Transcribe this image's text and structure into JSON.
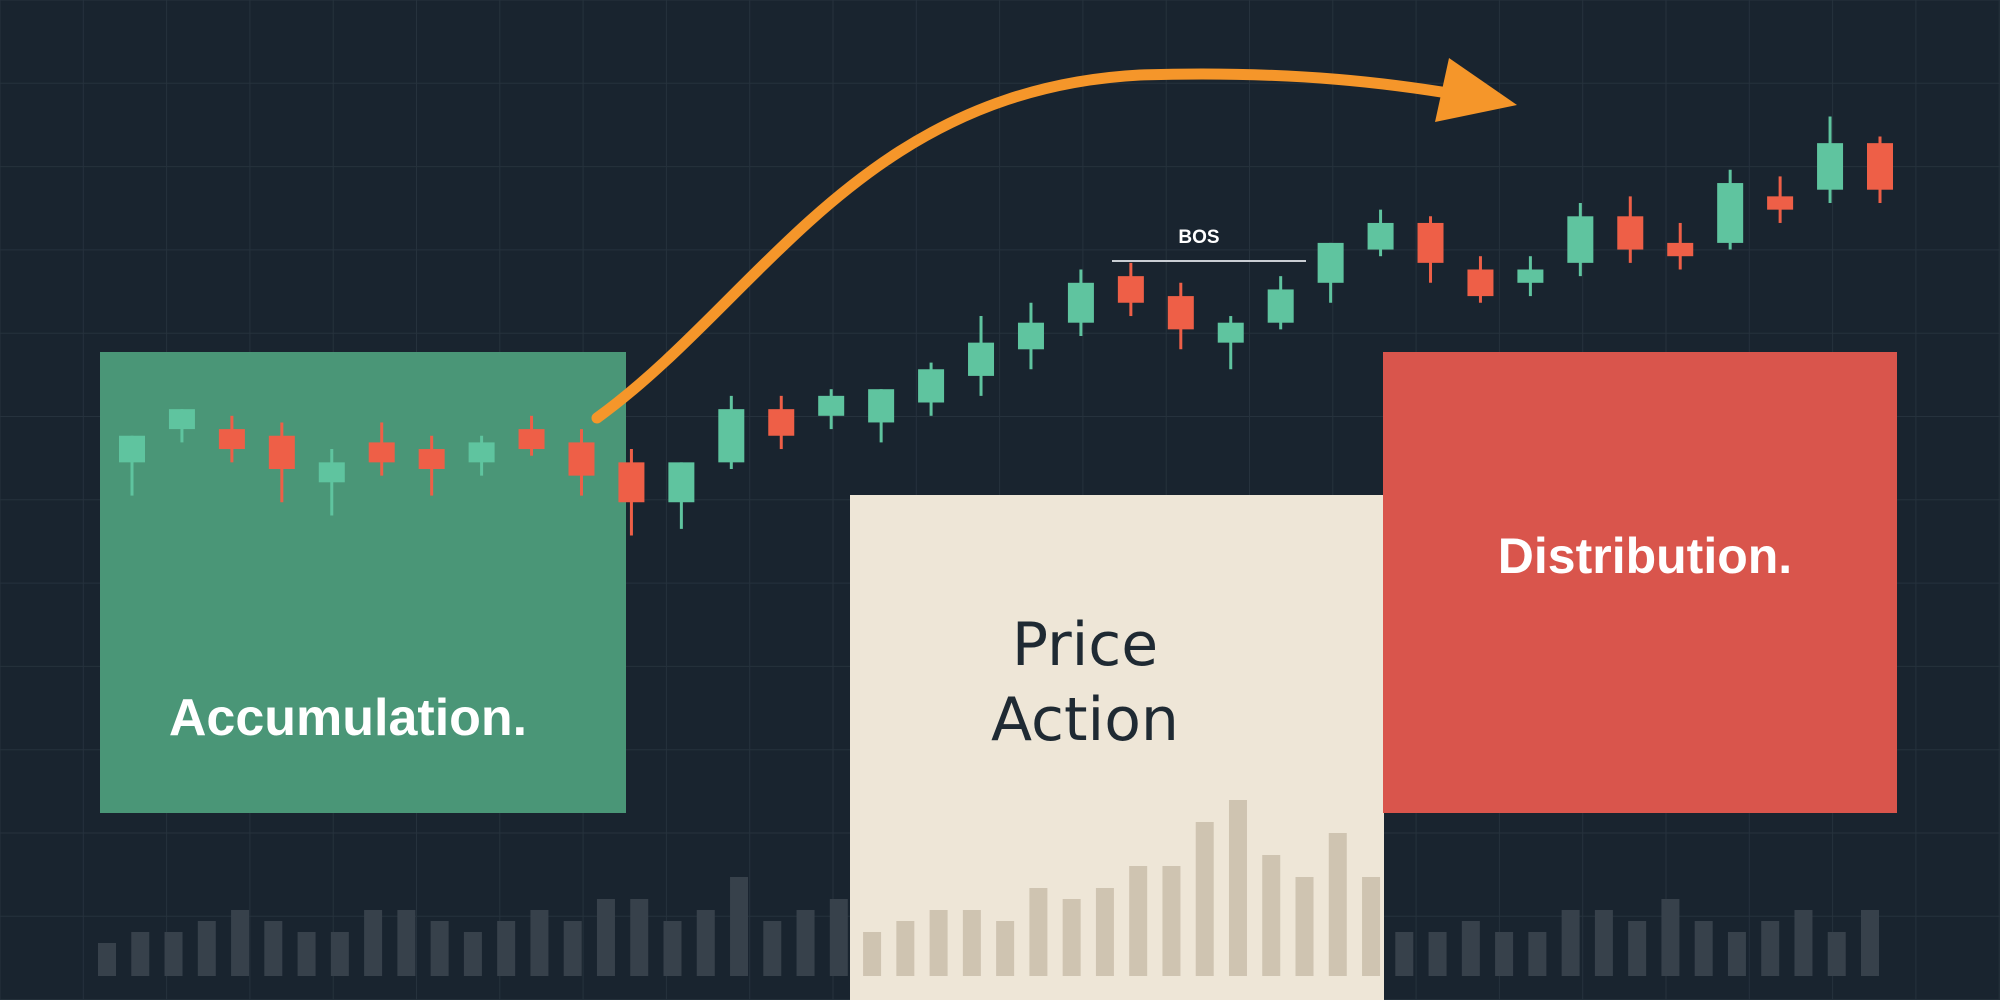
{
  "labels": {
    "accumulation": "Accumulation.",
    "price_action_line1": "Price",
    "price_action_line2": "Action",
    "distribution": "Distribution.",
    "bos": "BOS"
  },
  "colors": {
    "background": "#19242f",
    "grid": "#26323d",
    "bull": "#5fc49f",
    "bear": "#ee5f47",
    "accumulation_box": "#4a9677",
    "price_action_box": "#eee6d7",
    "distribution_box": "#d9554c",
    "arrow": "#f5962a",
    "volume_dark": "#37414b",
    "volume_light": "#cfc4b1",
    "label_light": "#ffffff",
    "label_dark": "#1f2a33"
  },
  "chart_data": {
    "type": "candlestick",
    "title": "",
    "xlabel": "",
    "ylabel": "",
    "ylim": [
      0,
      100
    ],
    "candles": [
      {
        "o": 41,
        "h": 45,
        "l": 36,
        "c": 45
      },
      {
        "o": 46,
        "h": 49,
        "l": 44,
        "c": 49
      },
      {
        "o": 46,
        "h": 48,
        "l": 41,
        "c": 43
      },
      {
        "o": 45,
        "h": 47,
        "l": 35,
        "c": 40
      },
      {
        "o": 38,
        "h": 43,
        "l": 33,
        "c": 41
      },
      {
        "o": 44,
        "h": 47,
        "l": 39,
        "c": 41
      },
      {
        "o": 43,
        "h": 45,
        "l": 36,
        "c": 40
      },
      {
        "o": 41,
        "h": 45,
        "l": 39,
        "c": 44
      },
      {
        "o": 46,
        "h": 48,
        "l": 42,
        "c": 43
      },
      {
        "o": 44,
        "h": 46,
        "l": 36,
        "c": 39
      },
      {
        "o": 41,
        "h": 43,
        "l": 30,
        "c": 35
      },
      {
        "o": 35,
        "h": 41,
        "l": 31,
        "c": 41
      },
      {
        "o": 41,
        "h": 51,
        "l": 40,
        "c": 49
      },
      {
        "o": 49,
        "h": 51,
        "l": 43,
        "c": 45
      },
      {
        "o": 48,
        "h": 52,
        "l": 46,
        "c": 51
      },
      {
        "o": 47,
        "h": 52,
        "l": 44,
        "c": 52
      },
      {
        "o": 50,
        "h": 56,
        "l": 48,
        "c": 55
      },
      {
        "o": 54,
        "h": 63,
        "l": 51,
        "c": 59
      },
      {
        "o": 58,
        "h": 65,
        "l": 55,
        "c": 62
      },
      {
        "o": 62,
        "h": 70,
        "l": 60,
        "c": 68
      },
      {
        "o": 69,
        "h": 71,
        "l": 63,
        "c": 65
      },
      {
        "o": 66,
        "h": 68,
        "l": 58,
        "c": 61
      },
      {
        "o": 59,
        "h": 63,
        "l": 55,
        "c": 62
      },
      {
        "o": 62,
        "h": 69,
        "l": 61,
        "c": 67
      },
      {
        "o": 68,
        "h": 74,
        "l": 65,
        "c": 74
      },
      {
        "o": 73,
        "h": 79,
        "l": 72,
        "c": 77
      },
      {
        "o": 77,
        "h": 78,
        "l": 68,
        "c": 71
      },
      {
        "o": 70,
        "h": 72,
        "l": 65,
        "c": 66
      },
      {
        "o": 68,
        "h": 72,
        "l": 66,
        "c": 70
      },
      {
        "o": 71,
        "h": 80,
        "l": 69,
        "c": 78
      },
      {
        "o": 78,
        "h": 81,
        "l": 71,
        "c": 73
      },
      {
        "o": 74,
        "h": 77,
        "l": 70,
        "c": 72
      },
      {
        "o": 74,
        "h": 85,
        "l": 73,
        "c": 83
      },
      {
        "o": 81,
        "h": 84,
        "l": 77,
        "c": 79
      },
      {
        "o": 82,
        "h": 93,
        "l": 80,
        "c": 89
      },
      {
        "o": 89,
        "h": 90,
        "l": 80,
        "c": 82
      }
    ],
    "volume": [
      3,
      4,
      4,
      5,
      6,
      5,
      4,
      4,
      6,
      6,
      5,
      4,
      5,
      6,
      5,
      7,
      7,
      5,
      6,
      9,
      5,
      6,
      7,
      4,
      5,
      6,
      6,
      5,
      8,
      7,
      8,
      10,
      10,
      14,
      16,
      11,
      9,
      13,
      9,
      4,
      4,
      5,
      4,
      4,
      6,
      6,
      5,
      7,
      5,
      4,
      5,
      6,
      4,
      6
    ],
    "annotations": [
      {
        "text": "BOS",
        "type": "level",
        "y": 78
      }
    ]
  }
}
